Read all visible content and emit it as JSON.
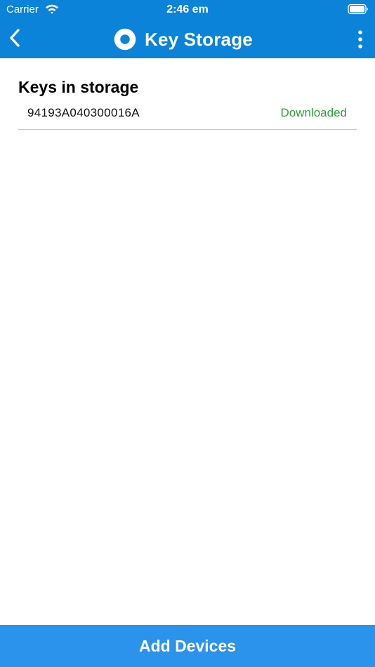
{
  "status_bar": {
    "carrier": "Carrier",
    "time": "2:46 em"
  },
  "nav": {
    "title": "Key Storage",
    "back_icon": "chevron-left-icon",
    "logo_icon": "ring-logo-icon",
    "more_icon": "vertical-ellipsis-icon"
  },
  "keys_section": {
    "title": "Keys in storage",
    "items": [
      {
        "id": "94193A040300016A",
        "status": "Downloaded"
      }
    ]
  },
  "footer": {
    "add_devices_label": "Add Devices"
  },
  "colors": {
    "header_blue": "#0a83d8",
    "button_blue": "#2b93ec",
    "status_green": "#2e9e3a",
    "divider_gray": "#c8c8c8"
  }
}
